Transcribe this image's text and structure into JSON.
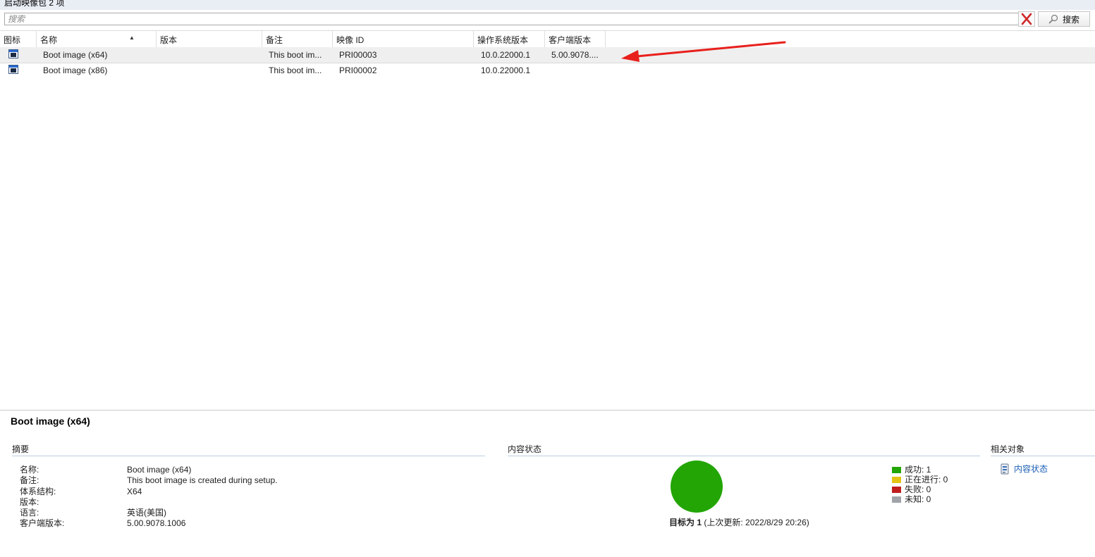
{
  "header": {
    "title": "启动映像包 2 项"
  },
  "search": {
    "placeholder": "搜索",
    "value": "",
    "button_label": "搜索"
  },
  "columns": [
    "图标",
    "名称",
    "版本",
    "备注",
    "映像 ID",
    "操作系统版本",
    "客户端版本"
  ],
  "rows": [
    {
      "name": "Boot image (x64)",
      "version": "",
      "comment": "This boot im...",
      "image_id": "PRI00003",
      "os_version": "10.0.22000.1",
      "client_version": "5.00.9078....",
      "selected": true
    },
    {
      "name": "Boot image (x86)",
      "version": "",
      "comment": "This boot im...",
      "image_id": "PRI00002",
      "os_version": "10.0.22000.1",
      "client_version": "",
      "selected": false
    }
  ],
  "details": {
    "title": "Boot image (x64)",
    "summary": {
      "heading": "摘要",
      "fields": [
        {
          "label": "名称:",
          "value": "Boot image (x64)"
        },
        {
          "label": "备注:",
          "value": "This boot image is created during setup."
        },
        {
          "label": "体系结构:",
          "value": "X64"
        },
        {
          "label": "版本:",
          "value": ""
        },
        {
          "label": "语言:",
          "value": "英语(美国)"
        },
        {
          "label": "客户端版本:",
          "value": "5.00.9078.1006"
        }
      ]
    },
    "content_status": {
      "heading": "内容状态",
      "target_label": "目标为 1",
      "last_update": "(上次更新: 2022/8/29 20:26)",
      "legend": [
        {
          "label": "成功: 1",
          "color": "#22a505"
        },
        {
          "label": "正在进行: 0",
          "color": "#e3c314"
        },
        {
          "label": "失败: 0",
          "color": "#c01c1c"
        },
        {
          "label": "未知: 0",
          "color": "#a0a4a8"
        }
      ]
    },
    "related": {
      "heading": "相关对象",
      "link": "内容状态"
    }
  },
  "colors": {
    "accent": "#1a5fb4",
    "arrow": "#e8201c",
    "success": "#22a505"
  }
}
